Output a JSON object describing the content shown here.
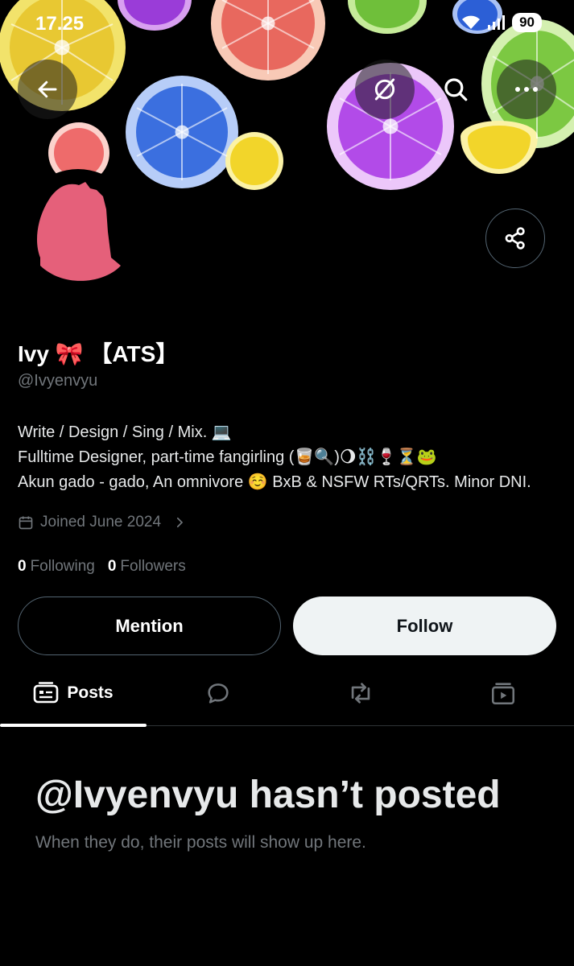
{
  "status_bar": {
    "time": "17.25",
    "battery": "90"
  },
  "header": {
    "back_icon": "arrow-left-icon",
    "grok_icon": "grok-icon",
    "search_icon": "search-icon",
    "more_icon": "more-horizontal-icon"
  },
  "profile": {
    "name": "Ivy 🎀 【ATS】",
    "handle": "@Ivyenvyu",
    "bio_lines": [
      "Write / Design / Sing / Mix. 💻",
      "Fulltime Designer, part-time fangirling (🥃🔍)🌖⛓️🍷⏳🐸",
      "Akun gado - gado, An omnivore ☺️ BxB & NSFW RTs/QRTs. Minor DNI."
    ],
    "joined": "Joined June 2024",
    "following_count": "0",
    "following_label": "Following",
    "followers_count": "0",
    "followers_label": "Followers"
  },
  "actions": {
    "mention": "Mention",
    "follow": "Follow"
  },
  "tabs": [
    {
      "label": "Posts",
      "icon": "posts-icon",
      "selected": true
    },
    {
      "label": "",
      "icon": "replies-icon"
    },
    {
      "label": "",
      "icon": "reposts-icon"
    },
    {
      "label": "",
      "icon": "media-icon"
    }
  ],
  "empty_state": {
    "title": "@Ivyenvyu hasn’t posted",
    "subtitle": "When they do, their posts will show up here."
  },
  "colors": {
    "background": "#000000",
    "text_primary": "#e7e9ea",
    "text_secondary": "#71767b",
    "border": "#536471",
    "follow_button": "#eff3f4",
    "avatar": "#e5607a"
  }
}
